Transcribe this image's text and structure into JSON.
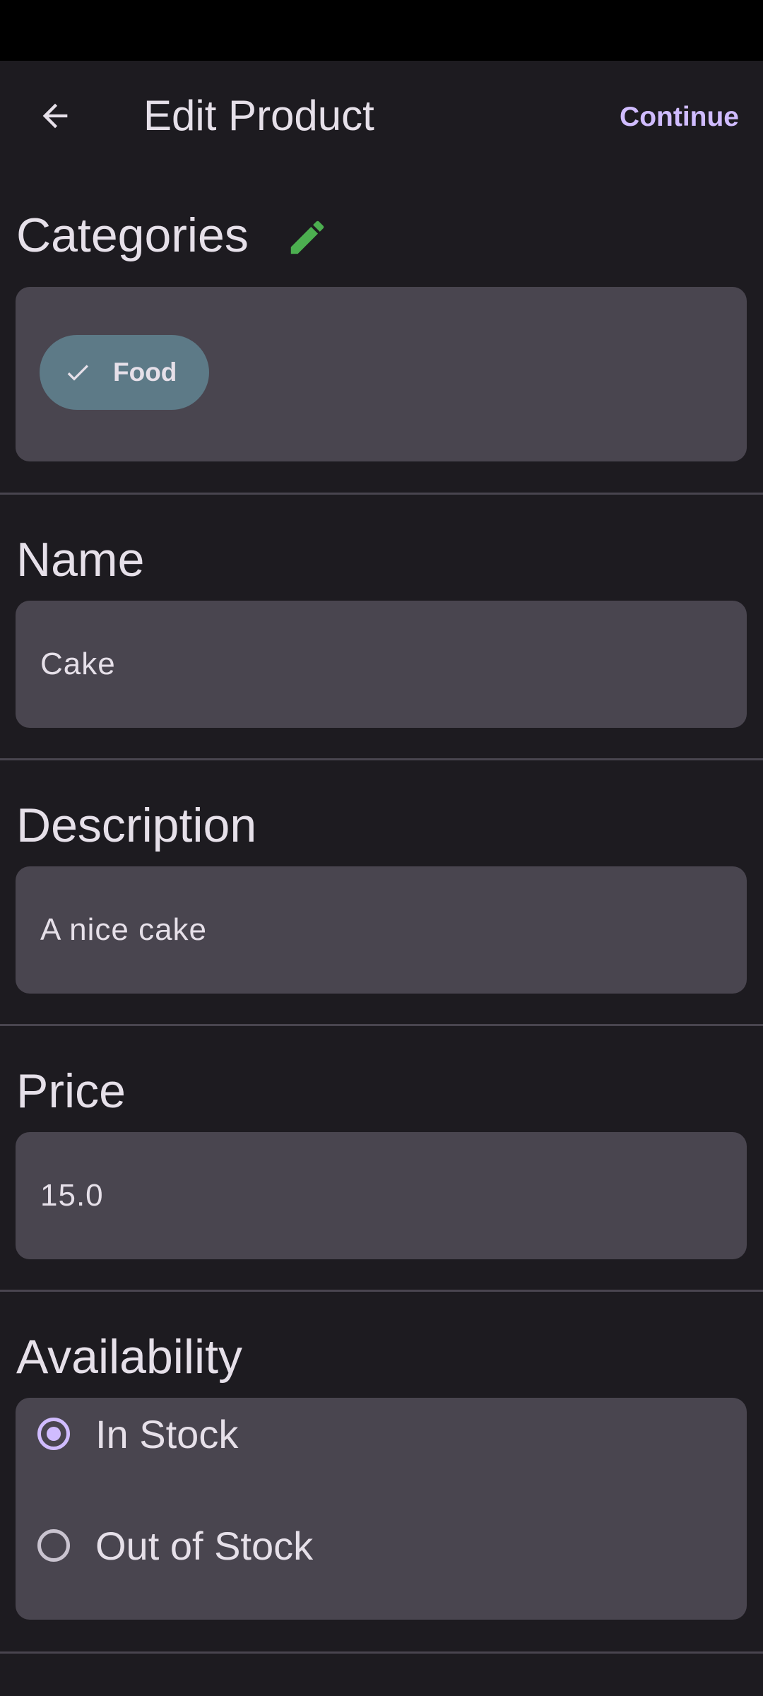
{
  "app_bar": {
    "title": "Edit Product",
    "continue_label": "Continue"
  },
  "categories": {
    "title": "Categories",
    "chips": [
      {
        "label": "Food",
        "selected": true
      }
    ]
  },
  "name": {
    "title": "Name",
    "value": "Cake"
  },
  "description": {
    "title": "Description",
    "value": "A nice cake"
  },
  "price": {
    "title": "Price",
    "value": "15.0"
  },
  "availability": {
    "title": "Availability",
    "options": [
      {
        "label": "In Stock",
        "selected": true
      },
      {
        "label": "Out of Stock",
        "selected": false
      }
    ]
  },
  "colors": {
    "background": "#1d1b20",
    "card": "#49454f",
    "accent": "#d0bcff",
    "edit_icon": "#4caf50",
    "chip": "#5d7a87"
  }
}
